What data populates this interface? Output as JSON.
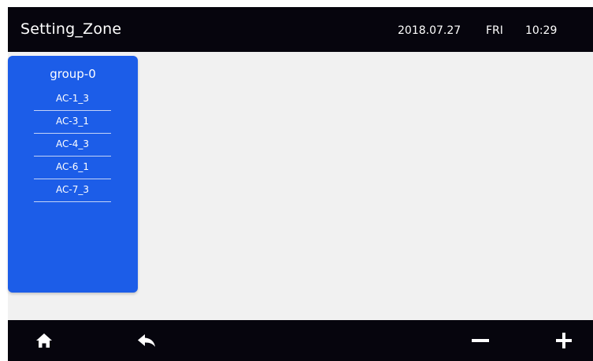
{
  "header": {
    "title": "Setting_Zone",
    "date": "2018.07.27",
    "weekday": "FRI",
    "time": "10:29"
  },
  "group": {
    "name": "group-0",
    "members": [
      "AC-1_3",
      "AC-3_1",
      "AC-4_3",
      "AC-6_1",
      "AC-7_3"
    ]
  },
  "footer": {
    "buttons": [
      "home-icon",
      "back-icon",
      "minus-icon",
      "plus-icon"
    ]
  },
  "colors": {
    "bar_background": "#06050d",
    "content_background": "#f1f1f1",
    "group_card": "#1c5de8",
    "text_light": "#ffffff"
  }
}
